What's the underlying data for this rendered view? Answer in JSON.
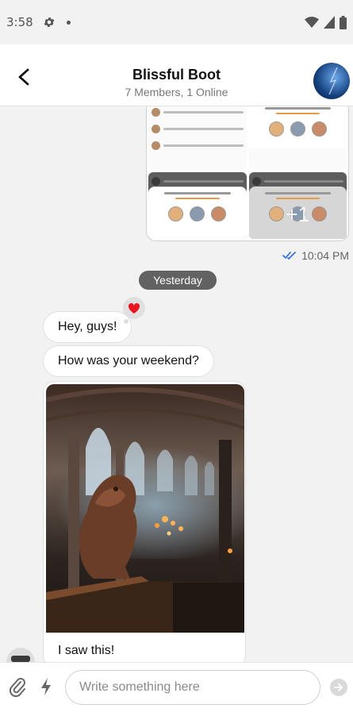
{
  "status_bar": {
    "time": "3:58",
    "icons": [
      "gear-icon",
      "notification-dot-icon",
      "wifi-icon",
      "signal-icon",
      "battery-icon"
    ]
  },
  "header": {
    "back_icon": "back-arrow-icon",
    "title": "Blissful Boot",
    "subtitle": "7 Members, 1 Online",
    "avatar_icon": "group-avatar"
  },
  "messages": {
    "gallery": {
      "more_count": "+1",
      "sent_time": "10:04 PM",
      "status_icon": "double-check-icon"
    },
    "day_separator": "Yesterday",
    "incoming": [
      {
        "text": "Hey, guys!",
        "reaction": "heart-icon"
      },
      {
        "text": "How was your weekend?"
      }
    ],
    "photo_message": {
      "caption": "I saw this!"
    }
  },
  "composer": {
    "attach_icon": "paperclip-icon",
    "commands_icon": "lightning-icon",
    "placeholder": "Write something here",
    "send_icon": "send-icon"
  },
  "colors": {
    "background": "#f2f2f2",
    "separator": "#626262",
    "read_check": "#2b6cd8",
    "heart": "#e8141e"
  }
}
